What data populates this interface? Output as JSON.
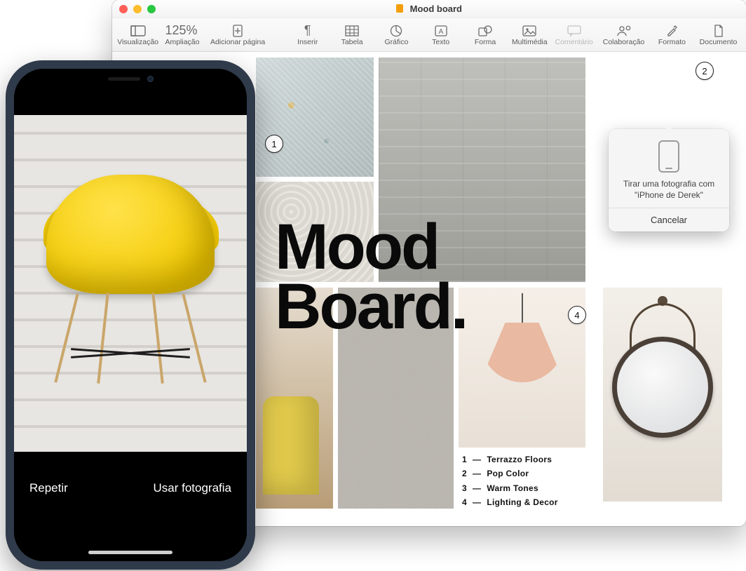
{
  "window": {
    "title": "Mood board"
  },
  "toolbar": {
    "view_label": "Visualização",
    "zoom_value": "125%",
    "zoom_label": "Ampliação",
    "addpage_label": "Adicionar página",
    "insert_label": "Inserir",
    "table_label": "Tabela",
    "chart_label": "Gráfico",
    "text_label": "Texto",
    "shape_label": "Forma",
    "media_label": "Multimédia",
    "comment_label": "Comentário",
    "collab_label": "Colaboração",
    "format_label": "Formato",
    "document_label": "Documento"
  },
  "document": {
    "title_line1": "Mood",
    "title_line2": "Board.",
    "legend": [
      {
        "n": "1",
        "dash": "—",
        "label": "Terrazzo Floors"
      },
      {
        "n": "2",
        "dash": "—",
        "label": "Pop Color"
      },
      {
        "n": "3",
        "dash": "—",
        "label": "Warm Tones"
      },
      {
        "n": "4",
        "dash": "—",
        "label": "Lighting & Decor"
      }
    ],
    "callouts": {
      "c1": "1",
      "c2": "2",
      "c4": "4"
    }
  },
  "popover": {
    "message": "Tirar uma fotografia com \"iPhone de Derek\"",
    "cancel": "Cancelar"
  },
  "iphone": {
    "retake": "Repetir",
    "use": "Usar fotografia"
  }
}
